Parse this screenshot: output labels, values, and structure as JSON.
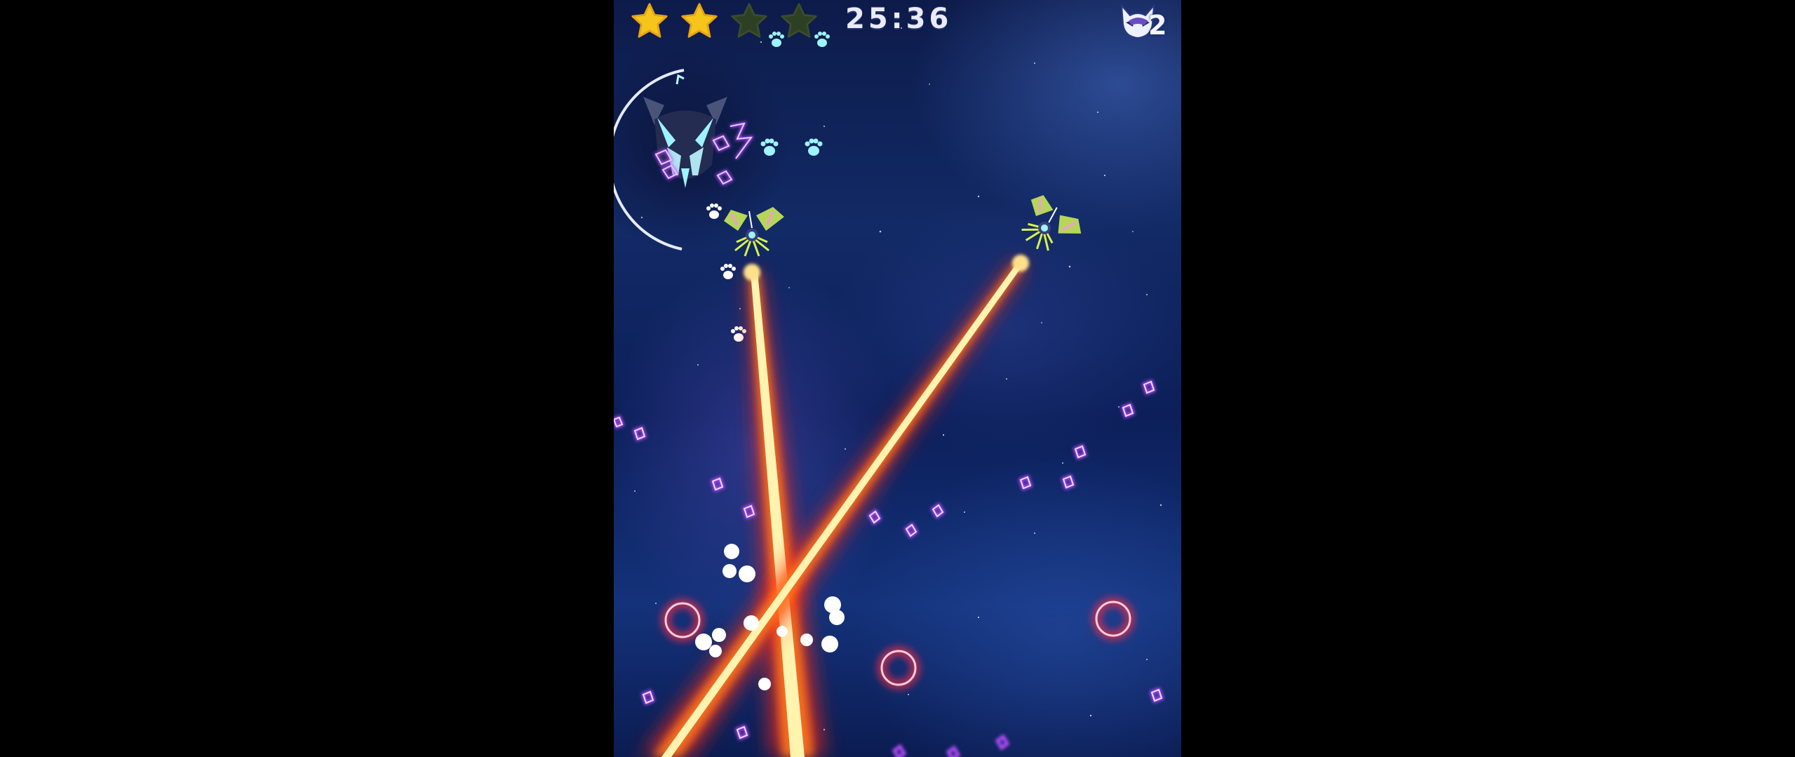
{
  "hud": {
    "stars_total": 4,
    "stars_earned": 2,
    "timer": "25:36",
    "lives": "2"
  },
  "colors": {
    "star_filled": "#f6c51c",
    "star_empty": "#2e4024",
    "laser_core": "#fff3b0",
    "laser_glow": "#ff3b1f",
    "enemy_outline": "#b94cff",
    "ring_enemy": "#ff2a45",
    "paw_print": "#9ef3ff"
  },
  "icons": {
    "star": "star-icon",
    "lives": "cat-head-icon",
    "boss": "cat-skull-boss-icon",
    "ship": "winged-ship-icon",
    "pickup": "paw-print-icon"
  }
}
